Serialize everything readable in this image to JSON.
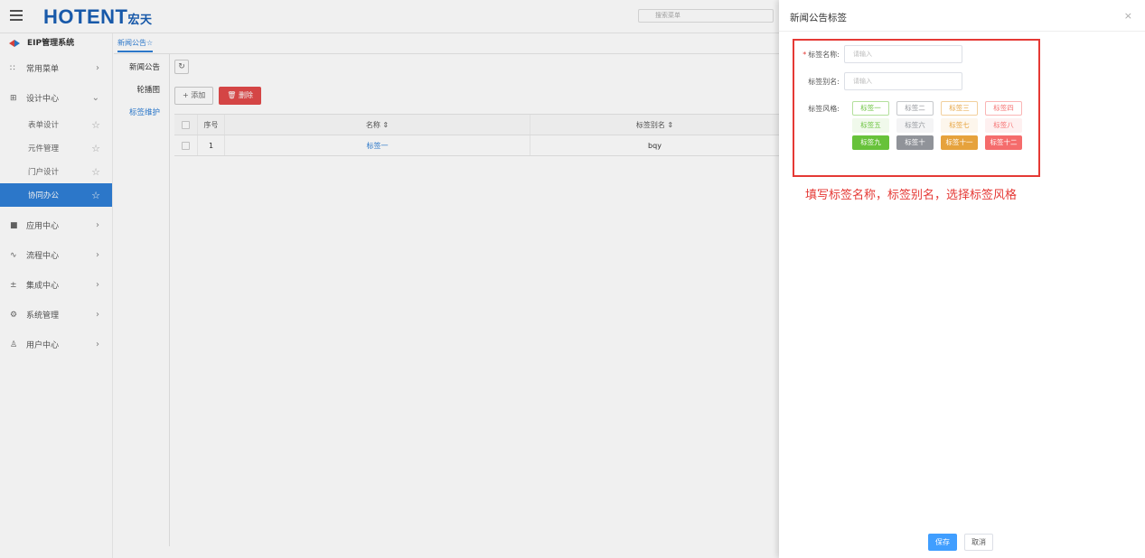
{
  "header": {
    "logo_main": "HOTENT",
    "logo_sub": "宏天",
    "search_placeholder": "搜索菜单"
  },
  "sidebar": {
    "system_name": "EIP管理系统",
    "groups": [
      {
        "label": "常用菜单",
        "icon": "grid-icon",
        "arrow": "›"
      },
      {
        "label": "设计中心",
        "icon": "design-icon",
        "arrow": "⌄"
      }
    ],
    "sub_items": [
      {
        "label": "表单设计"
      },
      {
        "label": "元件管理"
      },
      {
        "label": "门户设计"
      },
      {
        "label": "协同办公"
      }
    ],
    "more_groups": [
      {
        "label": "应用中心",
        "arrow": "›"
      },
      {
        "label": "流程中心",
        "arrow": "›"
      },
      {
        "label": "集成中心",
        "arrow": "›"
      },
      {
        "label": "系统管理",
        "arrow": "›"
      },
      {
        "label": "用户中心",
        "arrow": "›"
      }
    ]
  },
  "main": {
    "active_tab": "新闻公告☆",
    "left_nav": [
      "新闻公告",
      "轮播图",
      "标签维护"
    ],
    "toolbar": {
      "refresh": "↻",
      "add": "+ 添加",
      "delete": "🗑 删除"
    },
    "table": {
      "headers": {
        "index": "序号",
        "name": "名称 ⇕",
        "alias": "标签别名 ⇕"
      },
      "rows": [
        {
          "index": "1",
          "name": "标签一",
          "alias": "bqy"
        }
      ]
    }
  },
  "drawer": {
    "title": "新闻公告标签",
    "close": "×",
    "name_label": "标签名称:",
    "name_required": "*",
    "name_placeholder": "请输入",
    "alias_label": "标签别名:",
    "alias_placeholder": "请输入",
    "style_label": "标签风格:",
    "tags": [
      {
        "label": "标签一",
        "variant": "plain",
        "color": "#67c23a"
      },
      {
        "label": "标签二",
        "variant": "plain",
        "color": "#909399"
      },
      {
        "label": "标签三",
        "variant": "plain",
        "color": "#e6a23c"
      },
      {
        "label": "标签四",
        "variant": "plain",
        "color": "#f56c6c"
      },
      {
        "label": "标签五",
        "variant": "light",
        "color": "#67c23a"
      },
      {
        "label": "标签六",
        "variant": "light",
        "color": "#909399"
      },
      {
        "label": "标签七",
        "variant": "light",
        "color": "#e6a23c"
      },
      {
        "label": "标签八",
        "variant": "light",
        "color": "#f56c6c"
      },
      {
        "label": "标签九",
        "variant": "dark",
        "color": "#67c23a"
      },
      {
        "label": "标签十",
        "variant": "dark",
        "color": "#909399"
      },
      {
        "label": "标签十一",
        "variant": "dark",
        "color": "#e6a23c"
      },
      {
        "label": "标签十二",
        "variant": "dark",
        "color": "#f56c6c"
      }
    ],
    "annotation": "填写标签名称，标签别名，选择标签风格",
    "save": "保存",
    "cancel": "取消"
  }
}
